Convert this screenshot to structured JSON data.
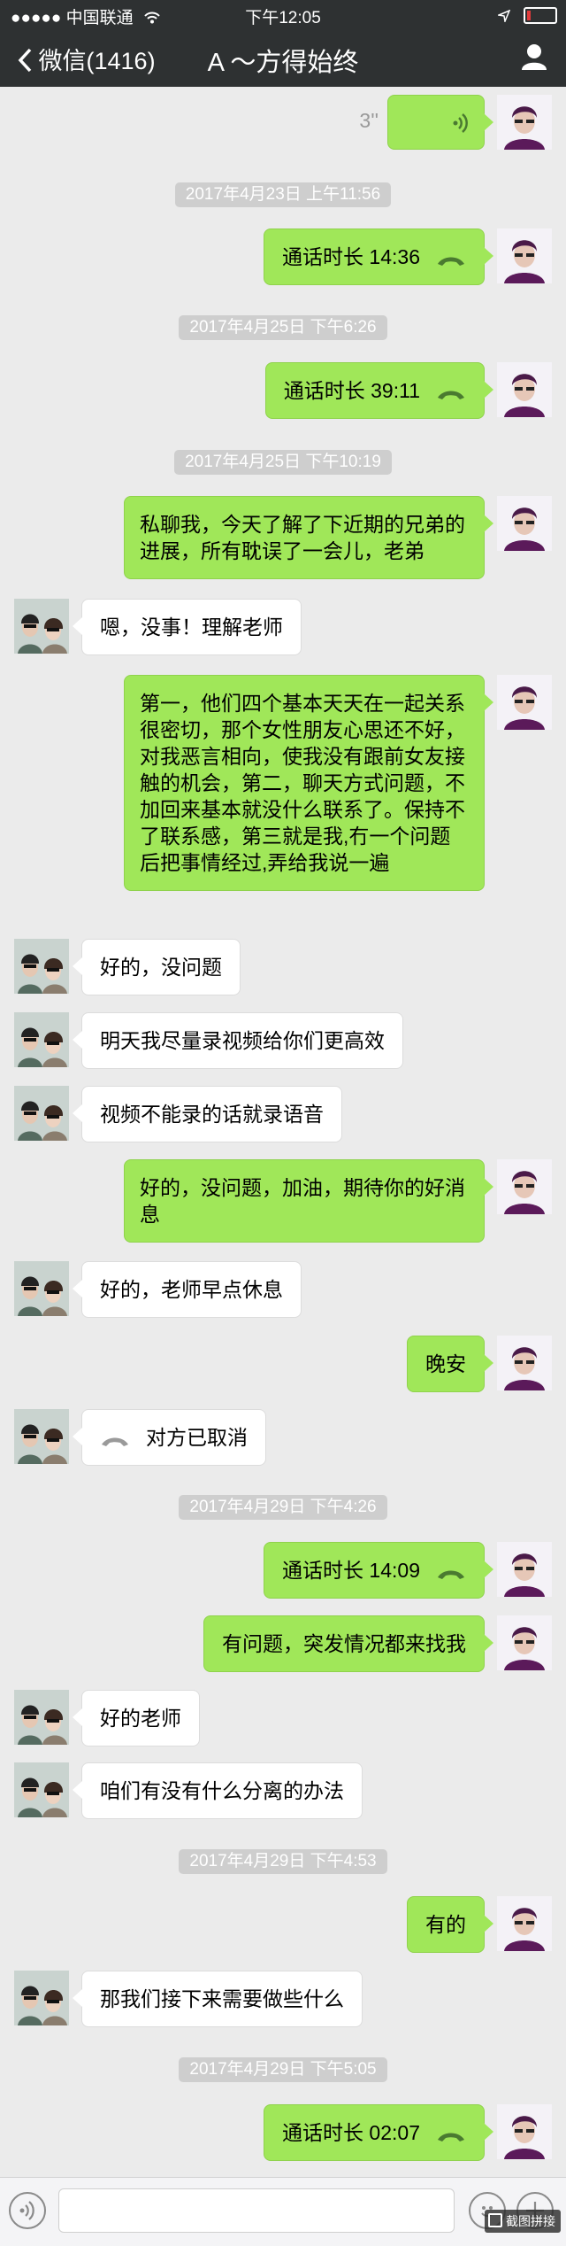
{
  "status_bar": {
    "carrier": "●●●●● 中国联通",
    "time": "下午12:05"
  },
  "header": {
    "back_label": "微信(1416)",
    "title": "A ～方得始终"
  },
  "messages": [
    {
      "type": "voice",
      "dir": "out",
      "duration": "3''"
    },
    {
      "type": "time",
      "text": "2017年4月23日 上午11:56"
    },
    {
      "type": "call",
      "dir": "out",
      "text": "通话时长 14:36"
    },
    {
      "type": "time",
      "text": "2017年4月25日 下午6:26"
    },
    {
      "type": "call",
      "dir": "out",
      "text": "通话时长 39:11"
    },
    {
      "type": "time",
      "text": "2017年4月25日 下午10:19"
    },
    {
      "type": "text",
      "dir": "out",
      "text": "私聊我，今天了解了下近期的兄弟的进展，所有耽误了一会儿，老弟"
    },
    {
      "type": "text",
      "dir": "in",
      "text": "嗯，没事！理解老师"
    },
    {
      "type": "text",
      "dir": "out",
      "text": "第一，他们四个基本天天在一起关系很密切，那个女性朋友心思还不好，对我恶言相向，使我没有跟前女友接触的机会，第二，聊天方式问题，不加回来基本就没什么联系了。保持不了联系感，第三就是我,冇一个问题后把事情经过,弄给我说一遍"
    },
    {
      "type": "text",
      "dir": "in",
      "text": "好的，没问题"
    },
    {
      "type": "text",
      "dir": "in",
      "text": "明天我尽量录视频给你们更高效"
    },
    {
      "type": "text",
      "dir": "in",
      "text": "视频不能录的话就录语音"
    },
    {
      "type": "text",
      "dir": "out",
      "text": "好的，没问题，加油，期待你的好消息"
    },
    {
      "type": "text",
      "dir": "in",
      "text": "好的，老师早点休息"
    },
    {
      "type": "text",
      "dir": "out",
      "text": "晚安"
    },
    {
      "type": "call",
      "dir": "in",
      "text": "对方已取消"
    },
    {
      "type": "time",
      "text": "2017年4月29日 下午4:26"
    },
    {
      "type": "call",
      "dir": "out",
      "text": "通话时长 14:09"
    },
    {
      "type": "text",
      "dir": "out",
      "text": "有问题，突发情况都来找我"
    },
    {
      "type": "text",
      "dir": "in",
      "text": "好的老师"
    },
    {
      "type": "text",
      "dir": "in",
      "text": "咱们有没有什么分离的办法"
    },
    {
      "type": "time",
      "text": "2017年4月29日 下午4:53"
    },
    {
      "type": "text",
      "dir": "out",
      "text": "有的"
    },
    {
      "type": "text",
      "dir": "in",
      "text": "那我们接下来需要做些什么"
    },
    {
      "type": "time",
      "text": "2017年4月29日 下午5:05"
    },
    {
      "type": "call",
      "dir": "out",
      "text": "通话时长 02:07"
    }
  ],
  "watermark": "截图拼接",
  "colors": {
    "bar": "#2e3132",
    "bubble_out": "#a0e759",
    "bubble_in": "#ffffff",
    "background": "#ebebeb",
    "timestamp": "#cecece"
  },
  "icons": [
    "chevron-left-icon",
    "person-icon",
    "wifi-icon",
    "location-arrow-icon",
    "battery-icon",
    "voice-wave-icon",
    "phone-icon",
    "voice-input-icon",
    "emoji-icon",
    "plus-icon"
  ]
}
